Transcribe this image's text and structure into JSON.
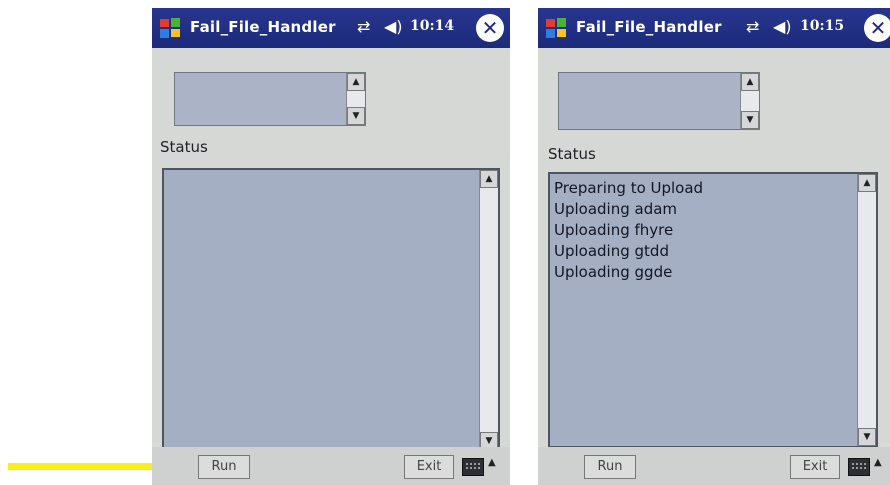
{
  "screens": [
    {
      "title_bar": {
        "app_title": "Fail_File_Handler",
        "time": "10:14",
        "close_glyph": "✕"
      },
      "status_label": "Status",
      "status_lines": [],
      "buttons": {
        "run_label": "Run",
        "exit_label": "Exit"
      }
    },
    {
      "title_bar": {
        "app_title": "Fail_File_Handler",
        "time": "10:15",
        "close_glyph": "✕"
      },
      "status_label": "Status",
      "status_lines": [
        "Preparing to Upload",
        "Uploading adam",
        "Uploading fhyre",
        "Uploading gtdd",
        "Uploading ggde"
      ],
      "buttons": {
        "run_label": "Run",
        "exit_label": "Exit"
      }
    }
  ],
  "annotation": {
    "arrow_color": "#f7ee1a",
    "points_to": "run-button"
  },
  "colors": {
    "title_bar": "#1f2c80",
    "form_background": "#d6d8d6",
    "list_background": "#a4afc4"
  },
  "icons": [
    "windows-start-icon",
    "connectivity-icon",
    "volume-icon",
    "close-icon",
    "keyboard-icon",
    "scroll-up-icon",
    "scroll-down-icon"
  ]
}
